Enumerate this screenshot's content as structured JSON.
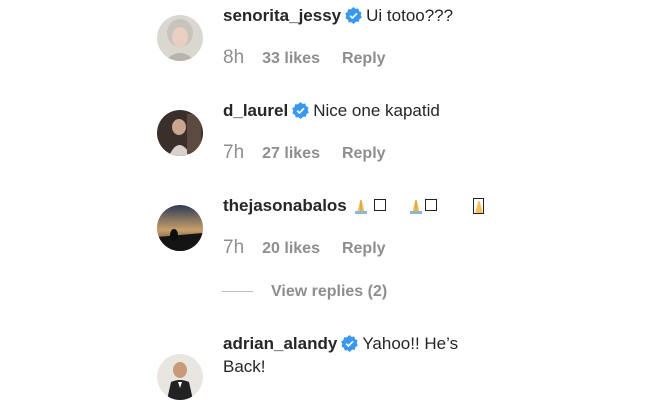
{
  "comments": [
    {
      "username": "senorita_jessy",
      "text": "Ui totoo???",
      "time": "8h",
      "likes": "33 likes",
      "reply": "Reply"
    },
    {
      "username": "d_laurel",
      "text": "Nice one kapatid",
      "time": "7h",
      "likes": "27 likes",
      "reply": "Reply"
    },
    {
      "username": "thejasonabalos",
      "text": "",
      "time": "7h",
      "likes": "20 likes",
      "reply": "Reply",
      "view_replies": "View replies (2)"
    },
    {
      "username": "adrian_alandy",
      "text": "Yahoo!! He’s",
      "text_line2": "Back!"
    }
  ],
  "colors": {
    "verified": "#3897f0",
    "muted": "#8e8e8e",
    "text": "#262626"
  },
  "icons": [
    "verified-badge-icon",
    "folded-hands-emoji-icon",
    "missing-glyph-icon"
  ]
}
